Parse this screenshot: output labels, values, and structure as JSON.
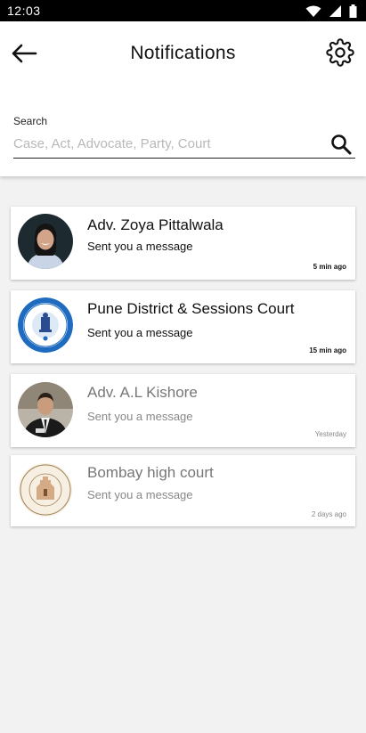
{
  "status_bar": {
    "time": "12:03"
  },
  "header": {
    "title": "Notifications"
  },
  "search": {
    "label": "Search",
    "placeholder": "Case, Act, Advocate, Party, Court",
    "value": ""
  },
  "notifications": [
    {
      "name": "Adv. Zoya Pittalwala",
      "message": "Sent you a message",
      "time": "5 min ago",
      "read": false
    },
    {
      "name": "Pune District & Sessions Court",
      "message": "Sent you a message",
      "time": "15 min ago",
      "read": false
    },
    {
      "name": "Adv. A.L Kishore",
      "message": "Sent you a message",
      "time": "Yesterday",
      "read": true
    },
    {
      "name": "Bombay high court",
      "message": "Sent you a message",
      "time": "2 days ago",
      "read": true
    }
  ]
}
